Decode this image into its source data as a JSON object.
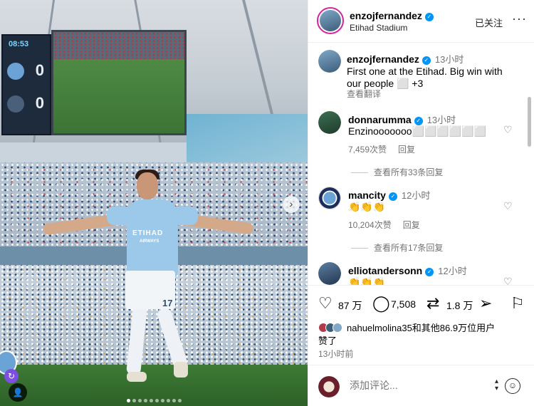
{
  "post": {
    "image": {
      "scoreboard_time": "08:53",
      "score_home": "0",
      "score_away": "0",
      "shirt_sponsor": "ETIHAD",
      "shirt_sponsor_sub": "AIRWAYS",
      "shirt_number": "17",
      "carousel_count": 10,
      "carousel_active_index": 0
    }
  },
  "header": {
    "username": "enzojfernandez",
    "location": "Etihad Stadium",
    "follow_label": "已关注",
    "more_label": "···"
  },
  "caption": {
    "username": "enzojfernandez",
    "time": "13小时",
    "text_line1": "First one at the Etihad. Big win with",
    "text_line2": "our people ⬜ +3",
    "translate_label": "查看翻译"
  },
  "comments": [
    {
      "username": "donnarumma",
      "time": "13小时",
      "text": "Enzinooooooo⬜⬜⬜⬜⬜⬜",
      "likes": "7,459次赞",
      "reply_label": "回复",
      "view_replies": "查看所有33条回复"
    },
    {
      "username": "mancity",
      "time": "12小时",
      "text": "👏👏👏",
      "likes": "10,204次赞",
      "reply_label": "回复",
      "view_replies": "查看所有17条回复"
    },
    {
      "username": "elliotandersonn",
      "time": "12小时",
      "text": "👏👏👏"
    }
  ],
  "actions": {
    "like_count": "87 万",
    "comment_count": "7,508",
    "repost_count": "1.8 万"
  },
  "likes_summary": {
    "line1": "nahuelmolina35和其他86.9万位用户",
    "line2": "赞了"
  },
  "time_ago": "13小时前",
  "add_comment": {
    "placeholder": "添加评论..."
  },
  "colors": {
    "verified": "#0095f6",
    "story_ring": "#d6249f",
    "secondary_text": "#737373",
    "city_blue": "#9cc8ea"
  },
  "icons": {
    "heart": "heart-icon",
    "comment": "comment-icon",
    "repost": "repost-icon",
    "share": "share-icon",
    "save": "bookmark-icon",
    "emoji": "emoji-icon"
  }
}
